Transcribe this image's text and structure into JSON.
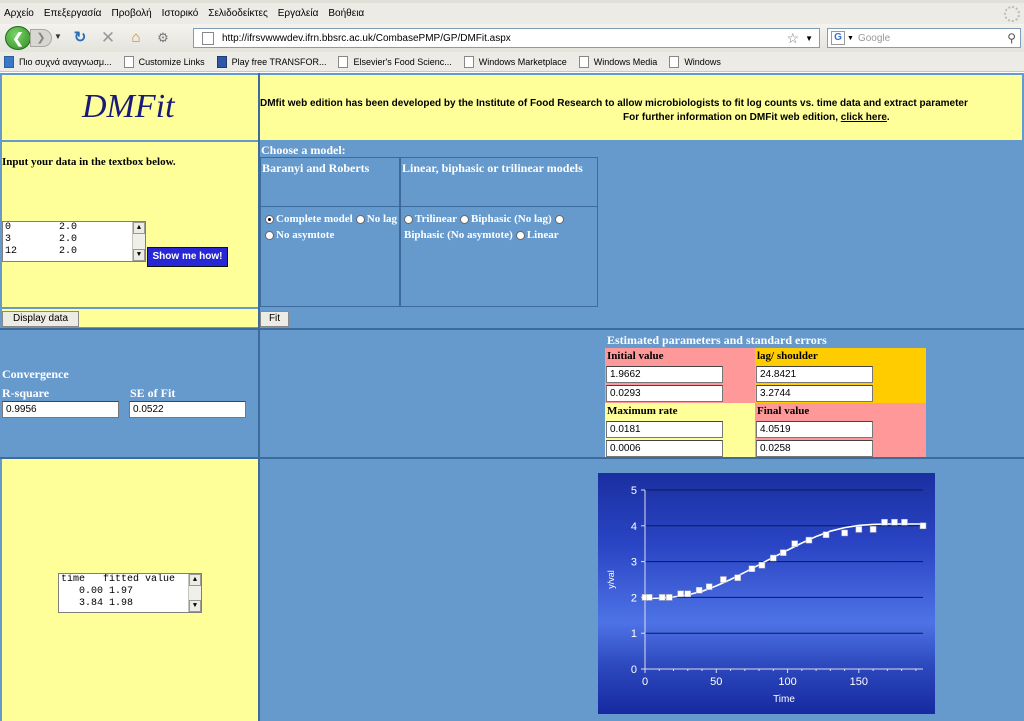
{
  "browser": {
    "menu": [
      "Αρχείο",
      "Επεξεργασία",
      "Προβολή",
      "Ιστορικό",
      "Σελιδοδείκτες",
      "Εργαλεία",
      "Βοήθεια"
    ],
    "url": "http://ifrsvwwwdev.ifrn.bbsrc.ac.uk/CombasePMP/GP/DMFit.aspx",
    "search_placeholder": "Google",
    "search_engine_letter": "G",
    "bookmarks": [
      "Πιο συχνά αναγνωσμ...",
      "Customize Links",
      "Play free TRANSFOR...",
      "Elsevier's Food Scienc...",
      "Windows Marketplace",
      "Windows Media",
      "Windows"
    ]
  },
  "header": {
    "logo": "DMFit",
    "intro_line1": "DMfit web edition has been developed by the Institute of Food Research to allow microbiologists to fit log counts vs. time data and extract parameter",
    "intro_line2_prefix": "For further information on DMFit web edition,",
    "intro_link": "click here",
    "intro_suffix": "."
  },
  "input_section": {
    "instruction": "Input your data in the textbox below.",
    "data_rows": [
      "0        2.0",
      "3        2.0",
      "12       2.0"
    ],
    "show_me_how": "Show me how!",
    "display_data": "Display data"
  },
  "model_section": {
    "heading": "Choose a model:",
    "col1_title": "Baranyi and Roberts",
    "col2_title": "Linear, biphasic or trilinear models",
    "col1_options": [
      "Complete model",
      "No lag",
      "No asymtote"
    ],
    "col2_options": [
      "Trilinear",
      "Biphasic (No lag)",
      "Biphasic (No asymtote)",
      "Linear"
    ],
    "fit_button": "Fit"
  },
  "convergence": {
    "title": "Convergence",
    "r_square_label": "R-square",
    "r_square_value": "0.9956",
    "se_label": "SE of Fit",
    "se_value": "0.0522"
  },
  "parameters": {
    "title": "Estimated parameters and standard errors",
    "initial_label": "Initial value",
    "initial_value": "1.9662",
    "initial_se": "0.0293",
    "lag_label": "lag/ shoulder",
    "lag_value": "24.8421",
    "lag_se": "3.2744",
    "max_rate_label": "Maximum rate",
    "max_rate_value": "0.0181",
    "max_rate_se": "0.0006",
    "final_label": "Final value",
    "final_value": "4.0519",
    "final_se": "0.0258",
    "colors": {
      "initial": "#ff9999",
      "lag": "#ffcc00",
      "max_rate": "#ffff99",
      "final": "#ff9999"
    }
  },
  "fitted_output": {
    "header": "time   fitted value",
    "rows": [
      "   0.00 1.97",
      "   3.84 1.98"
    ]
  },
  "chart_data": {
    "type": "scatter",
    "xlabel": "Time",
    "ylabel": "y/val",
    "xlim": [
      0,
      195
    ],
    "ylim": [
      0,
      5
    ],
    "x_ticks": [
      "0",
      "50",
      "100",
      "150"
    ],
    "y_ticks": [
      "0",
      "1",
      "2",
      "3",
      "4",
      "5"
    ],
    "grid": true,
    "series": [
      {
        "x": [
          0,
          3,
          12,
          17,
          25,
          30,
          38,
          45,
          55,
          65,
          75,
          82,
          90,
          97,
          105,
          115,
          127,
          140,
          150,
          160,
          168,
          175,
          182,
          195
        ],
        "y": [
          2.0,
          2.0,
          2.0,
          2.0,
          2.1,
          2.1,
          2.2,
          2.3,
          2.5,
          2.55,
          2.8,
          2.9,
          3.1,
          3.25,
          3.5,
          3.6,
          3.75,
          3.8,
          3.9,
          3.9,
          4.1,
          4.1,
          4.1,
          4.0
        ]
      },
      {
        "x": [
          0,
          10,
          20,
          30,
          40,
          50,
          60,
          70,
          80,
          90,
          100,
          110,
          120,
          130,
          140,
          150,
          160,
          170,
          180,
          195
        ],
        "y": [
          1.97,
          1.98,
          2.01,
          2.07,
          2.17,
          2.32,
          2.5,
          2.7,
          2.91,
          3.12,
          3.32,
          3.52,
          3.7,
          3.85,
          3.95,
          4.01,
          4.04,
          4.05,
          4.05,
          4.05
        ]
      }
    ],
    "colors": {
      "points": "#ffffff",
      "line": "#ffffff",
      "axis_text": "#ffffff"
    }
  }
}
